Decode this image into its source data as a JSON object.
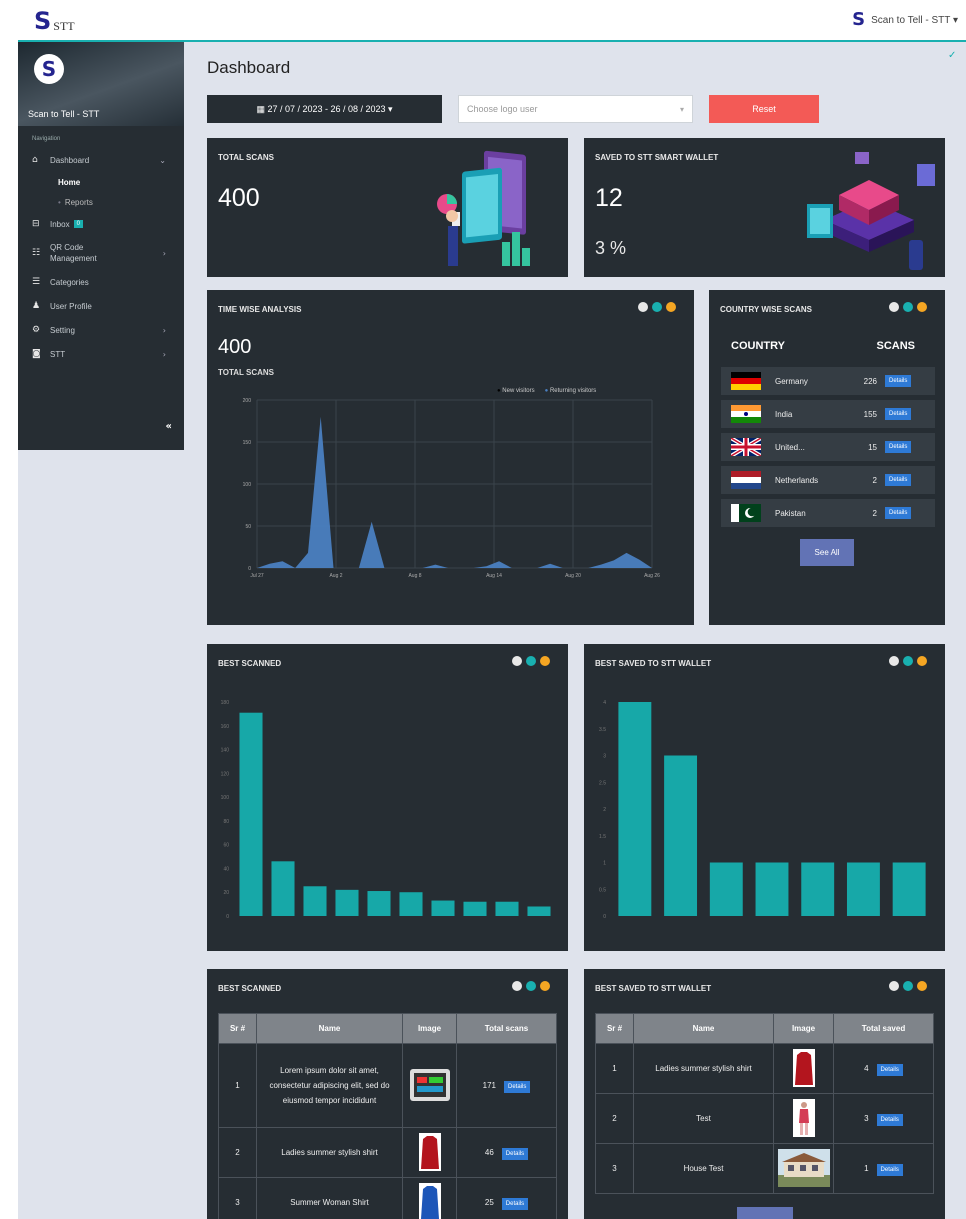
{
  "header": {
    "logo_letter": "S",
    "logo_text": "STT",
    "user_menu": "Scan to Tell - STT ▾"
  },
  "sidebar": {
    "brand_name": "Scan to Tell - STT",
    "nav_label": "Navigation",
    "items": [
      {
        "label": "Dashboard",
        "icon": "home-icon"
      },
      {
        "label": "Home",
        "sub": true,
        "active": true
      },
      {
        "label": "Reports",
        "sub": true
      },
      {
        "label": "Inbox",
        "icon": "inbox-icon",
        "badge": "0"
      },
      {
        "label": "QR Code Management",
        "icon": "qr-icon"
      },
      {
        "label": "Categories",
        "icon": "list-icon"
      },
      {
        "label": "User Profile",
        "icon": "user-icon"
      },
      {
        "label": "Setting",
        "icon": "gear-icon"
      },
      {
        "label": "STT",
        "icon": "stt-icon"
      }
    ],
    "collapse": "«"
  },
  "page": {
    "title": "Dashboard",
    "date_range": "▦ 27 / 07 / 2023 - 26 / 08 / 2023 ▾",
    "logo_user_placeholder": "Choose logo user",
    "reset_label": "Reset"
  },
  "stats": {
    "total_scans_title": "TOTAL SCANS",
    "total_scans_value": "400",
    "saved_title": "SAVED TO STT SMART WALLET",
    "saved_value": "12",
    "saved_pct": "3 %"
  },
  "time_analysis": {
    "title": "TIME WISE ANALYSIS",
    "total_value": "400",
    "total_label": "TOTAL SCANS",
    "legend_new": "New visitors",
    "legend_returning": "Returning visitors"
  },
  "country": {
    "title": "COUNTRY WISE SCANS",
    "col_country": "COUNTRY",
    "col_scans": "SCANS",
    "details_label": "Details",
    "see_all": "See All",
    "rows": [
      {
        "name": "Germany",
        "scans": "226",
        "flag": "de"
      },
      {
        "name": "India",
        "scans": "155",
        "flag": "in"
      },
      {
        "name": "United...",
        "scans": "15",
        "flag": "gb"
      },
      {
        "name": "Netherlands",
        "scans": "2",
        "flag": "nl"
      },
      {
        "name": "Pakistan",
        "scans": "2",
        "flag": "pk"
      }
    ]
  },
  "best_scanned_chart_title": "BEST SCANNED",
  "best_saved_chart_title": "BEST SAVED TO STT WALLET",
  "chart_data": [
    {
      "type": "area",
      "title": "TIME WISE ANALYSIS",
      "x_ticks": [
        "Jul 27",
        "Aug 2",
        "Aug 8",
        "Aug 14",
        "Aug 20",
        "Aug 26"
      ],
      "y_ticks": [
        0,
        50,
        100,
        150,
        200
      ],
      "ylim": [
        0,
        200
      ],
      "series": [
        {
          "name": "Returning visitors",
          "color": "#4a7fc1",
          "values": [
            0,
            5,
            8,
            0,
            18,
            180,
            0,
            0,
            0,
            55,
            0,
            0,
            0,
            0,
            4,
            0,
            0,
            0,
            2,
            8,
            0,
            0,
            0,
            5,
            0,
            0,
            0,
            4,
            9,
            18,
            10,
            0
          ]
        }
      ]
    },
    {
      "type": "bar",
      "title": "BEST SCANNED",
      "ylim": [
        0,
        180
      ],
      "y_ticks": [
        0,
        20,
        40,
        60,
        80,
        100,
        120,
        140,
        160,
        180
      ],
      "values": [
        171,
        46,
        25,
        22,
        21,
        20,
        13,
        12,
        12,
        8
      ],
      "color": "#17a8a8"
    },
    {
      "type": "bar",
      "title": "BEST SAVED TO STT WALLET",
      "ylim": [
        0,
        4
      ],
      "y_ticks": [
        0,
        0.5,
        1,
        1.5,
        2,
        2.5,
        3,
        3.5,
        4
      ],
      "values": [
        4,
        3,
        1,
        1,
        1,
        1,
        1
      ],
      "color": "#17a8a8"
    }
  ],
  "best_scanned_table": {
    "title": "BEST SCANNED",
    "headers": [
      "Sr #",
      "Name",
      "Image",
      "Total scans"
    ],
    "details_label": "Details",
    "rows": [
      {
        "sr": "1",
        "name": "Lorem ipsum dolor sit amet, consectetur adipiscing elit, sed do eiusmod tempor incididunt",
        "total": "171"
      },
      {
        "sr": "2",
        "name": "Ladies summer stylish shirt",
        "total": "46"
      },
      {
        "sr": "3",
        "name": "Summer Woman Shirt",
        "total": "25"
      }
    ]
  },
  "best_saved_table": {
    "title": "BEST SAVED TO STT WALLET",
    "headers": [
      "Sr #",
      "Name",
      "Image",
      "Total saved"
    ],
    "details_label": "Details",
    "rows": [
      {
        "sr": "1",
        "name": "Ladies summer stylish shirt",
        "total": "4"
      },
      {
        "sr": "2",
        "name": "Test",
        "total": "3"
      },
      {
        "sr": "3",
        "name": "House Test",
        "total": "1"
      }
    ]
  }
}
